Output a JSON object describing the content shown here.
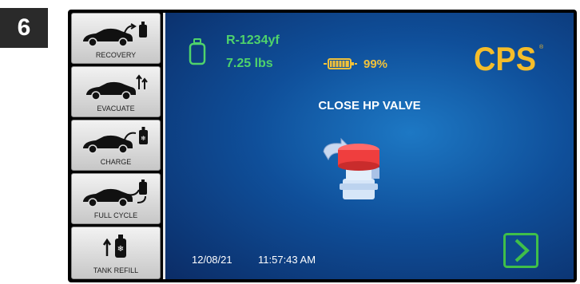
{
  "step_number": "6",
  "sidebar": {
    "items": [
      {
        "label": "RECOVERY",
        "icon": "car-hose-tank-icon"
      },
      {
        "label": "EVACUATE",
        "icon": "car-vacuum-arrows-icon"
      },
      {
        "label": "CHARGE",
        "icon": "car-hose-tank-snowflake-icon"
      },
      {
        "label": "FULL CYCLE",
        "icon": "car-cycle-icon"
      },
      {
        "label": "TANK REFILL",
        "icon": "tank-refill-icon"
      }
    ]
  },
  "status": {
    "refrigerant": "R-1234yf",
    "weight": "7.25 lbs",
    "battery_percent": "99%",
    "battery_level": 0.99
  },
  "brand": {
    "logo_text": "CPS",
    "trademark": "®"
  },
  "instruction": "CLOSE HP VALVE",
  "footer": {
    "date": "12/08/21",
    "time": "11:57:43 AM"
  },
  "colors": {
    "status_green": "#4fd36b",
    "battery_gold": "#f2c23a",
    "logo_gold": "#f5bd2a",
    "screen_blue": "#0f4f9a",
    "next_button_green": "#3fbf4a"
  }
}
